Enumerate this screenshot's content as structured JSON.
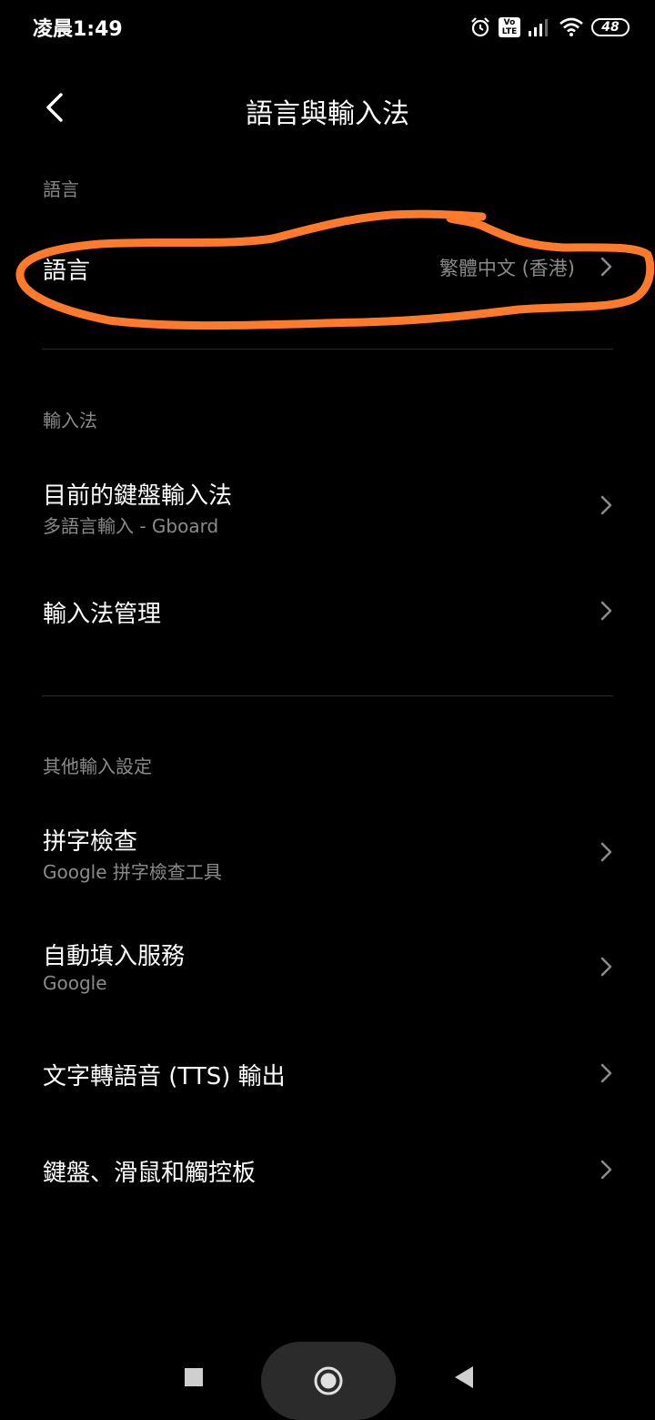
{
  "status_bar": {
    "time": "凌晨1:49",
    "volte_top": "Vo",
    "volte_bottom": "LTE",
    "battery": "48"
  },
  "header": {
    "title": "語言與輸入法",
    "back_icon": "chevron-left-icon"
  },
  "sections": {
    "language": {
      "label": "語言",
      "items": [
        {
          "title": "語言",
          "value": "繁體中文 (香港)"
        }
      ]
    },
    "input_method": {
      "label": "輸入法",
      "items": [
        {
          "title": "目前的鍵盤輸入法",
          "subtitle": "多語言輸入 - Gboard"
        },
        {
          "title": "輸入法管理"
        }
      ]
    },
    "other": {
      "label": "其他輸入設定",
      "items": [
        {
          "title": "拼字檢查",
          "subtitle": "Google 拼字檢查工具"
        },
        {
          "title": "自動填入服務",
          "subtitle": "Google"
        },
        {
          "title": "文字轉語音 (TTS) 輸出"
        },
        {
          "title": "鍵盤、滑鼠和觸控板"
        }
      ]
    }
  },
  "annotation": {
    "color": "#ff7a2a"
  },
  "colors": {
    "background": "#000000",
    "text_primary": "#ffffff",
    "text_secondary": "#8a8a8a"
  }
}
